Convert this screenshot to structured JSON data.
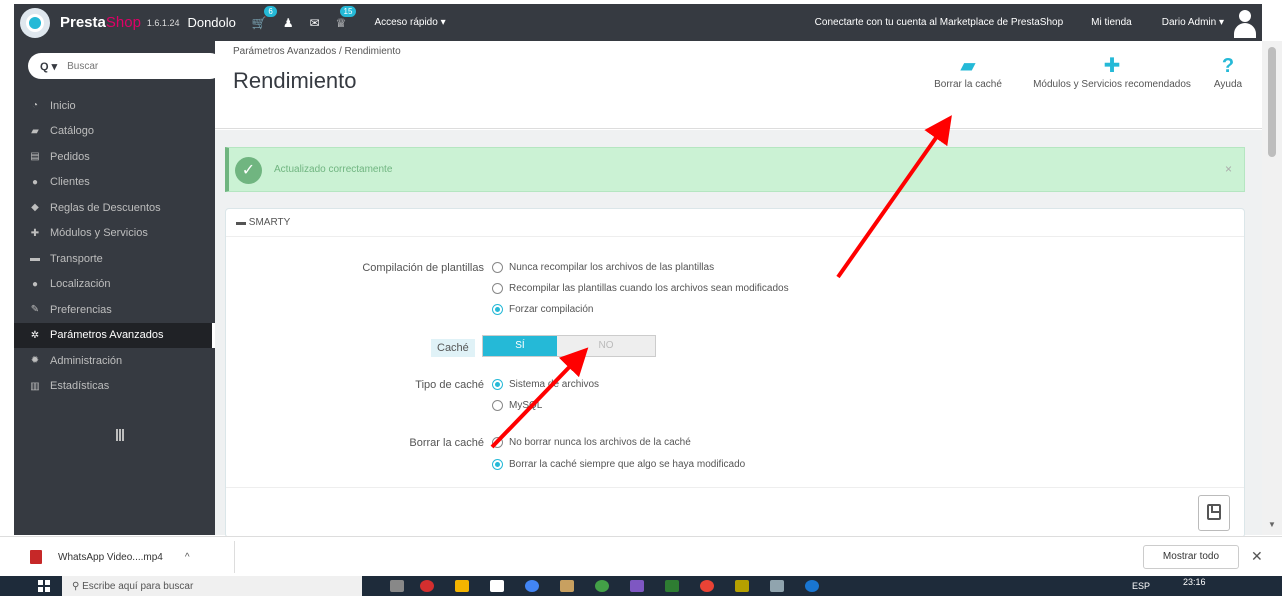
{
  "topbar": {
    "brand_presta": "Presta",
    "brand_shop": "Shop",
    "version": "1.6.1.24",
    "shop_name": "Dondolo",
    "cart_badge": "6",
    "trophy_badge": "15",
    "quick_access": "Acceso rápido ▾",
    "marketplace": "Conectarte con tu cuenta al Marketplace de PrestaShop",
    "my_shop": "Mi tienda",
    "admin_user": "Dario Admin ▾"
  },
  "sidebar": {
    "search_label": "Q ▾",
    "search_placeholder": "Buscar",
    "items": [
      {
        "label": "Inicio",
        "icon": "dashboard-icon",
        "glyph": "◔"
      },
      {
        "label": "Catálogo",
        "icon": "catalog-icon",
        "glyph": "▰"
      },
      {
        "label": "Pedidos",
        "icon": "orders-icon",
        "glyph": "▤"
      },
      {
        "label": "Clientes",
        "icon": "customers-icon",
        "glyph": "●"
      },
      {
        "label": "Reglas de Descuentos",
        "icon": "tag-icon",
        "glyph": "◆"
      },
      {
        "label": "Módulos y Servicios",
        "icon": "puzzle-icon",
        "glyph": "✚"
      },
      {
        "label": "Transporte",
        "icon": "truck-icon",
        "glyph": "▬"
      },
      {
        "label": "Localización",
        "icon": "globe-icon",
        "glyph": "●"
      },
      {
        "label": "Preferencias",
        "icon": "wrench-icon",
        "glyph": "✎"
      },
      {
        "label": "Parámetros Avanzados",
        "icon": "cogs-icon",
        "glyph": "✲"
      },
      {
        "label": "Administración",
        "icon": "gear-icon",
        "glyph": "✹"
      },
      {
        "label": "Estadísticas",
        "icon": "stats-icon",
        "glyph": "▥"
      }
    ]
  },
  "header": {
    "breadcrumb": "Parámetros Avanzados  /  Rendimiento",
    "title": "Rendimiento",
    "tools": [
      {
        "label": "Borrar la caché",
        "icon": "eraser-icon",
        "glyph": "▰"
      },
      {
        "label": "Módulos y Servicios recomendados",
        "icon": "puzzle-icon",
        "glyph": "✚"
      },
      {
        "label": "Ayuda",
        "icon": "help-icon",
        "glyph": "?"
      }
    ]
  },
  "alert": {
    "message": "Actualizado correctamente",
    "close": "×"
  },
  "panel": {
    "heading": "SMARTY",
    "compile_label": "Compilación de plantillas",
    "compile_options": [
      "Nunca recompilar los archivos de las plantillas",
      "Recompilar las plantillas cuando los archivos sean modificados",
      "Forzar compilación"
    ],
    "compile_selected": 2,
    "cache_label": "Caché",
    "cache_on": "SÍ",
    "cache_off": "NO",
    "cache_type_label": "Tipo de caché",
    "cache_type_options": [
      "Sistema de archivos",
      "MySQL"
    ],
    "cache_type_selected": 0,
    "clear_label": "Borrar la caché",
    "clear_options": [
      "No borrar nunca los archivos de la caché",
      "Borrar la caché siempre que algo se haya modificado"
    ],
    "clear_selected": 1
  },
  "downloads": {
    "file_name": "WhatsApp Video....mp4",
    "chevron": "^",
    "show_all": "Mostrar todo",
    "close": "✕"
  },
  "taskbar": {
    "search_placeholder": "Escribe aquí para buscar",
    "lang": "ESP",
    "time": "23:16"
  },
  "colors": {
    "accent": "#25b9d7",
    "sidebar_bg": "#363a41",
    "success": "#70b580",
    "annotation_arrow": "#ff0000"
  }
}
